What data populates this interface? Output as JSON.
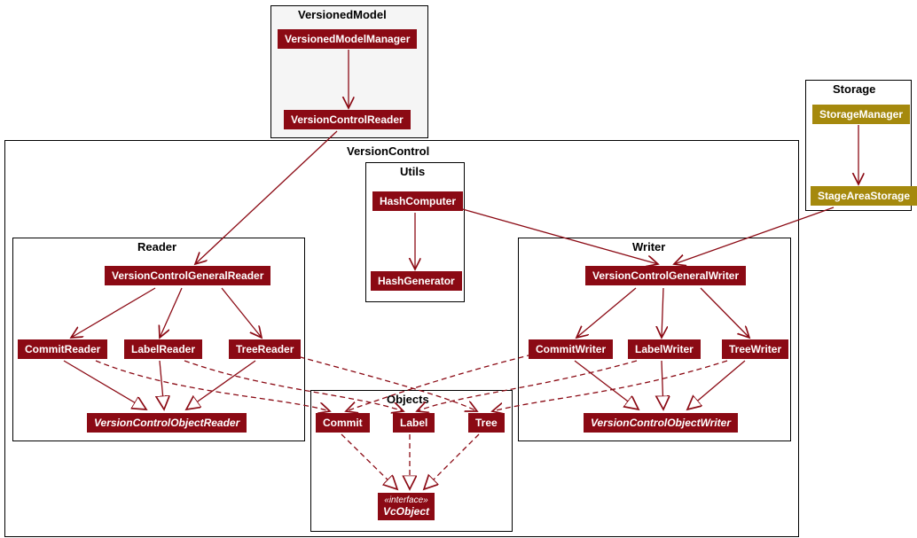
{
  "chart_data": {
    "type": "diagram",
    "packages": [
      {
        "name": "VersionedModel",
        "nodes": [
          "VersionedModelManager",
          "VersionControlReader"
        ]
      },
      {
        "name": "Storage",
        "nodes": [
          "StorageManager",
          "StageAreaStorage"
        ]
      },
      {
        "name": "VersionControl",
        "subpackages": [
          "Utils",
          "Reader",
          "Writer",
          "Objects"
        ]
      },
      {
        "name": "Utils",
        "nodes": [
          "HashComputer",
          "HashGenerator"
        ]
      },
      {
        "name": "Reader",
        "nodes": [
          "VersionControlGeneralReader",
          "CommitReader",
          "LabelReader",
          "TreeReader",
          "VersionControlObjectReader"
        ]
      },
      {
        "name": "Writer",
        "nodes": [
          "VersionControlGeneralWriter",
          "CommitWriter",
          "LabelWriter",
          "TreeWriter",
          "VersionControlObjectWriter"
        ]
      },
      {
        "name": "Objects",
        "nodes": [
          "Commit",
          "Label",
          "Tree",
          "VcObject"
        ]
      }
    ],
    "edges": [
      {
        "from": "VersionedModelManager",
        "to": "VersionControlReader",
        "style": "solid",
        "head": "arrow"
      },
      {
        "from": "VersionControlReader",
        "to": "VersionControlGeneralReader",
        "style": "solid",
        "head": "arrow"
      },
      {
        "from": "StorageManager",
        "to": "StageAreaStorage",
        "style": "solid",
        "head": "arrow"
      },
      {
        "from": "HashComputer",
        "to": "HashGenerator",
        "style": "solid",
        "head": "arrow"
      },
      {
        "from": "HashComputer",
        "to": "VersionControlGeneralWriter",
        "style": "solid",
        "head": "arrow"
      },
      {
        "from": "StageAreaStorage",
        "to": "VersionControlGeneralWriter",
        "style": "solid",
        "head": "arrow"
      },
      {
        "from": "VersionControlGeneralReader",
        "to": "CommitReader",
        "style": "solid",
        "head": "arrow"
      },
      {
        "from": "VersionControlGeneralReader",
        "to": "LabelReader",
        "style": "solid",
        "head": "arrow"
      },
      {
        "from": "VersionControlGeneralReader",
        "to": "TreeReader",
        "style": "solid",
        "head": "arrow"
      },
      {
        "from": "CommitReader",
        "to": "VersionControlObjectReader",
        "style": "solid",
        "head": "triangle"
      },
      {
        "from": "LabelReader",
        "to": "VersionControlObjectReader",
        "style": "solid",
        "head": "triangle"
      },
      {
        "from": "TreeReader",
        "to": "VersionControlObjectReader",
        "style": "solid",
        "head": "triangle"
      },
      {
        "from": "VersionControlGeneralWriter",
        "to": "CommitWriter",
        "style": "solid",
        "head": "arrow"
      },
      {
        "from": "VersionControlGeneralWriter",
        "to": "LabelWriter",
        "style": "solid",
        "head": "arrow"
      },
      {
        "from": "VersionControlGeneralWriter",
        "to": "TreeWriter",
        "style": "solid",
        "head": "arrow"
      },
      {
        "from": "CommitWriter",
        "to": "VersionControlObjectWriter",
        "style": "solid",
        "head": "triangle"
      },
      {
        "from": "LabelWriter",
        "to": "VersionControlObjectWriter",
        "style": "solid",
        "head": "triangle"
      },
      {
        "from": "TreeWriter",
        "to": "VersionControlObjectWriter",
        "style": "solid",
        "head": "triangle"
      },
      {
        "from": "CommitReader",
        "to": "Commit",
        "style": "dashed",
        "head": "arrow"
      },
      {
        "from": "LabelReader",
        "to": "Label",
        "style": "dashed",
        "head": "arrow"
      },
      {
        "from": "TreeReader",
        "to": "Tree",
        "style": "dashed",
        "head": "arrow"
      },
      {
        "from": "CommitWriter",
        "to": "Commit",
        "style": "dashed",
        "head": "arrow"
      },
      {
        "from": "LabelWriter",
        "to": "Label",
        "style": "dashed",
        "head": "arrow"
      },
      {
        "from": "TreeWriter",
        "to": "Tree",
        "style": "dashed",
        "head": "arrow"
      },
      {
        "from": "Commit",
        "to": "VcObject",
        "style": "dashed",
        "head": "triangle"
      },
      {
        "from": "Label",
        "to": "VcObject",
        "style": "dashed",
        "head": "triangle"
      },
      {
        "from": "Tree",
        "to": "VcObject",
        "style": "dashed",
        "head": "triangle"
      }
    ]
  },
  "pkg": {
    "versionedModel": "VersionedModel",
    "storage": "Storage",
    "versionControl": "VersionControl",
    "utils": "Utils",
    "reader": "Reader",
    "writer": "Writer",
    "objects": "Objects"
  },
  "cls": {
    "versionedModelManager": "VersionedModelManager",
    "versionControlReader": "VersionControlReader",
    "storageManager": "StorageManager",
    "stageAreaStorage": "StageAreaStorage",
    "hashComputer": "HashComputer",
    "hashGenerator": "HashGenerator",
    "versionControlGeneralReader": "VersionControlGeneralReader",
    "commitReader": "CommitReader",
    "labelReader": "LabelReader",
    "treeReader": "TreeReader",
    "versionControlObjectReader": "VersionControlObjectReader",
    "versionControlGeneralWriter": "VersionControlGeneralWriter",
    "commitWriter": "CommitWriter",
    "labelWriter": "LabelWriter",
    "treeWriter": "TreeWriter",
    "versionControlObjectWriter": "VersionControlObjectWriter",
    "commit": "Commit",
    "label": "Label",
    "tree": "Tree",
    "vcObject": "VcObject",
    "iface": "«interface»"
  }
}
